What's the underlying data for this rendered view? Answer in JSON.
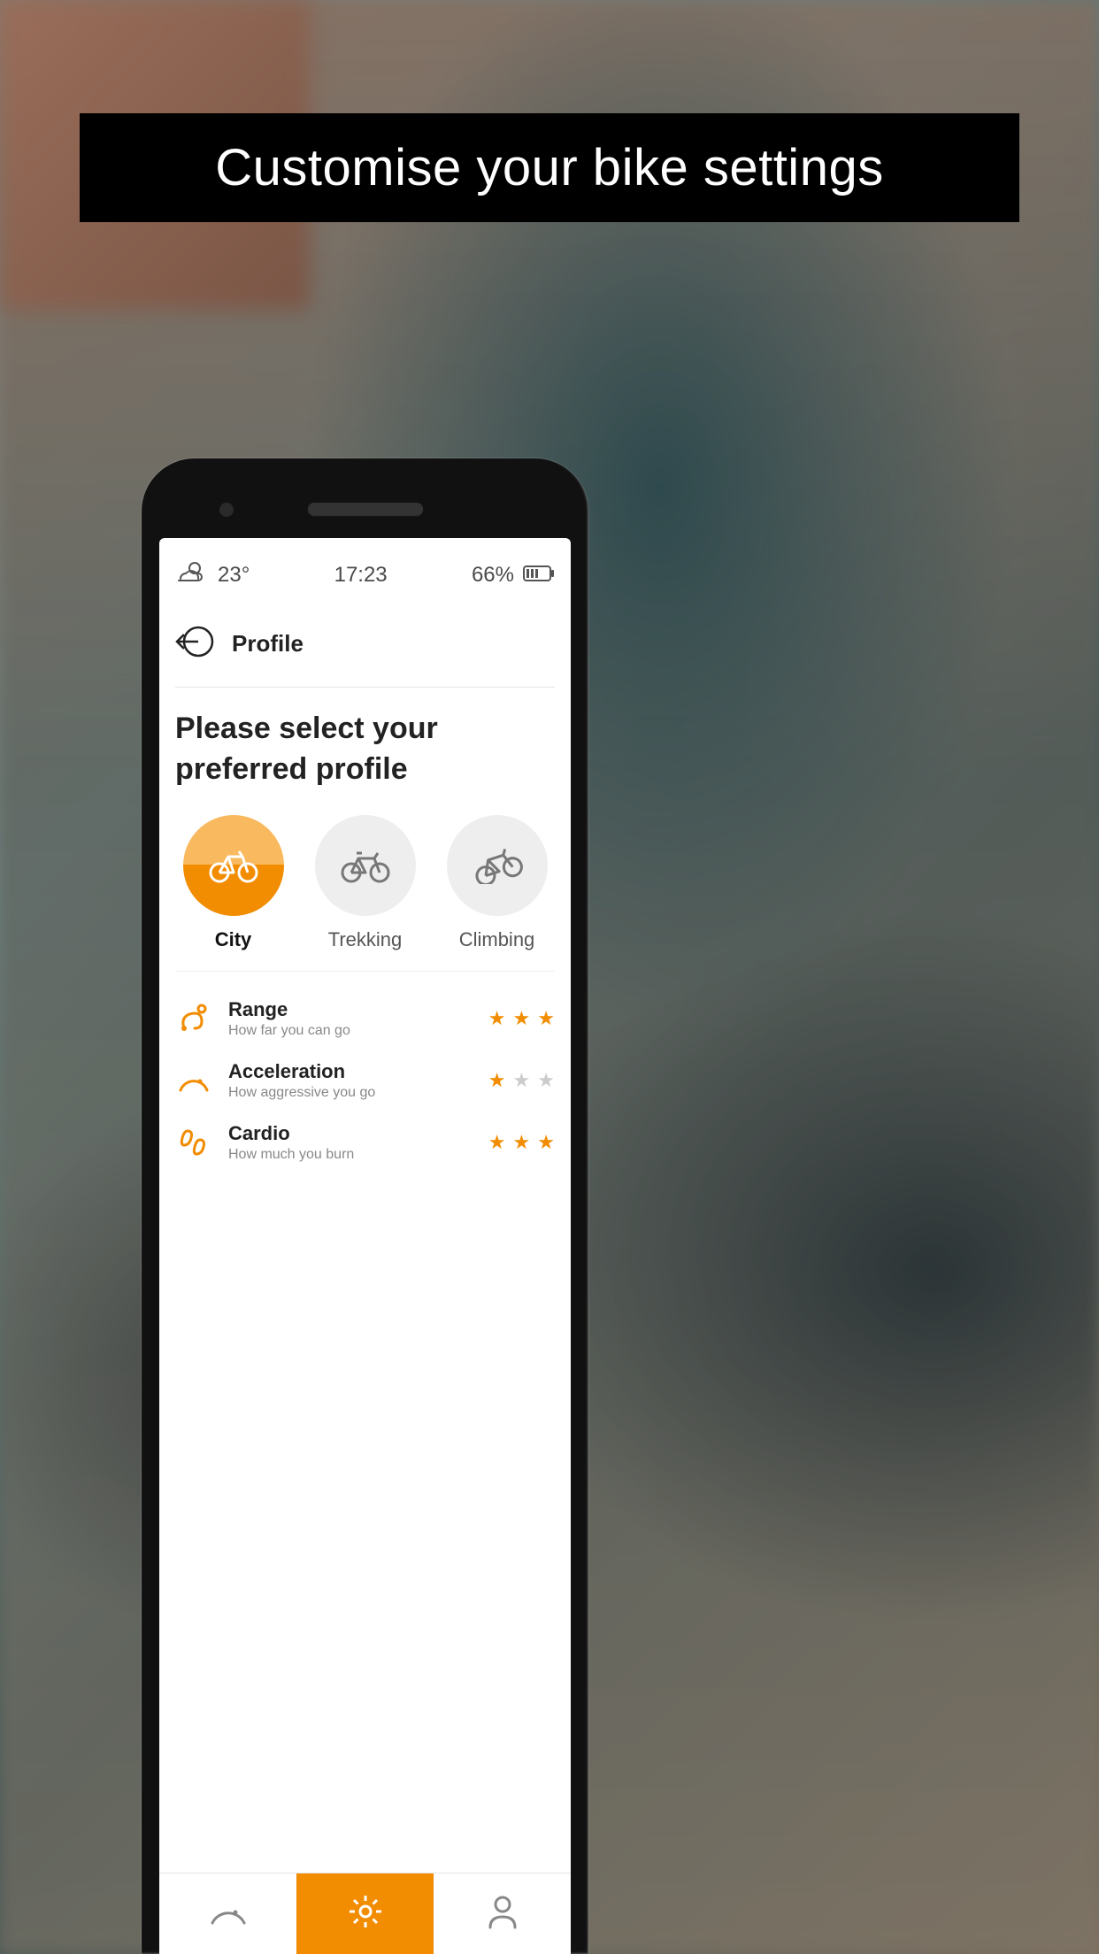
{
  "banner": {
    "title": "Customise your bike settings"
  },
  "status": {
    "temperature": "23°",
    "time": "17:23",
    "battery_percent": "66%"
  },
  "header": {
    "title": "Profile"
  },
  "content": {
    "heading": "Please select your preferred profile"
  },
  "profiles": [
    {
      "label": "City",
      "active": true
    },
    {
      "label": "Trekking",
      "active": false
    },
    {
      "label": "Climbing",
      "active": false
    }
  ],
  "metrics": [
    {
      "title": "Range",
      "subtitle": "How far you can go",
      "rating": 3
    },
    {
      "title": "Acceleration",
      "subtitle": "How aggressive you go",
      "rating": 1
    },
    {
      "title": "Cardio",
      "subtitle": "How much you burn",
      "rating": 3
    }
  ],
  "colors": {
    "accent": "#f28c00"
  }
}
